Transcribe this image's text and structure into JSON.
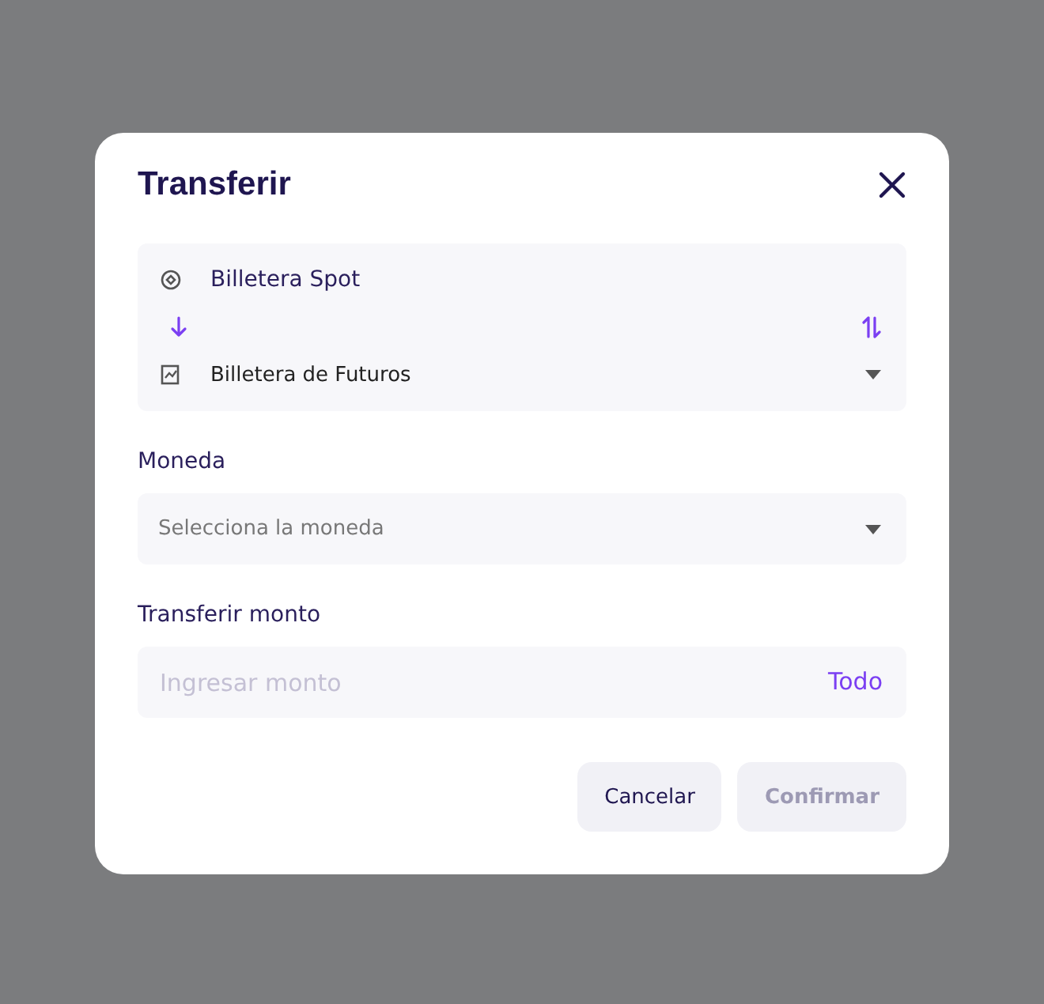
{
  "dialog": {
    "title": "Transferir"
  },
  "transfer": {
    "from": {
      "label": "Billetera Spot"
    },
    "to": {
      "label": "Billetera de Futuros"
    }
  },
  "currency": {
    "label": "Moneda",
    "placeholder": "Selecciona la moneda"
  },
  "amount": {
    "label": "Transferir monto",
    "placeholder": "Ingresar monto",
    "max_link": "Todo"
  },
  "buttons": [
    {
      "label": "Cancelar",
      "disabled": false
    },
    {
      "label": "Confirmar",
      "disabled": true
    }
  ]
}
